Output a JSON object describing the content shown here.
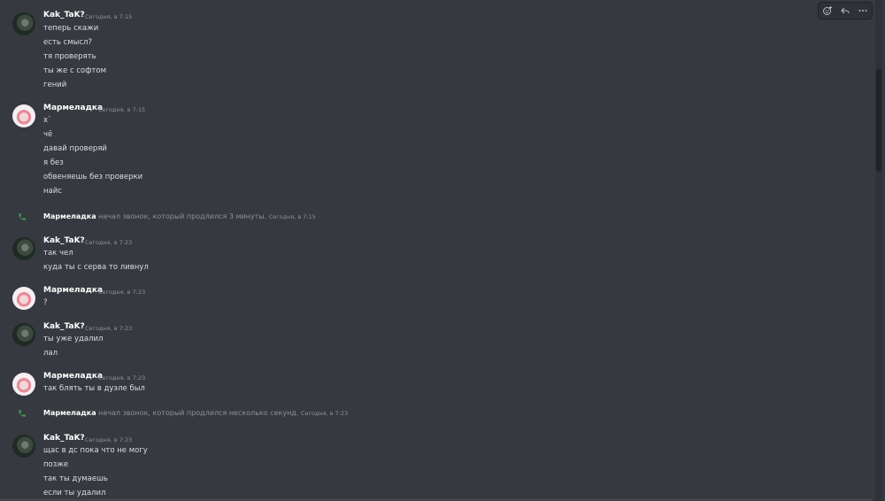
{
  "colors": {
    "background": "#36393f",
    "call_icon": "#3ba55c"
  },
  "toolbar": {
    "icons": [
      "add-reaction-icon",
      "reply-icon",
      "more-icon"
    ]
  },
  "messages": [
    {
      "author": "Kak_TaK?",
      "timestamp": "Сегодня, в 7:15",
      "avatar": "cat-avatar",
      "lines": [
        "теперь скажи",
        "есть смысл?",
        "тя проверять",
        "ты же с софтом",
        "гений"
      ]
    },
    {
      "author": "Мармеладка",
      "timestamp": "Сегодня, в 7:15",
      "avatar": "anime-avatar",
      "lines": [
        "х`",
        "чё",
        "давай проверяй",
        "я без",
        "обвеняешь без проверки",
        "найс"
      ]
    },
    {
      "type": "call",
      "author": "Мармеладка",
      "text": "начал звонок, который продлился 3 минуты.",
      "timestamp": "Сегодня, в 7:15"
    },
    {
      "author": "Kak_TaK?",
      "timestamp": "Сегодня, в 7:23",
      "avatar": "cat-avatar",
      "lines": [
        "так чел",
        "куда ты с серва то ливнул"
      ]
    },
    {
      "author": "Мармеладка",
      "timestamp": "Сегодня, в 7:23",
      "avatar": "anime-avatar",
      "lines": [
        "?"
      ]
    },
    {
      "author": "Kak_TaK?",
      "timestamp": "Сегодня, в 7:23",
      "avatar": "cat-avatar",
      "lines": [
        "ты уже удалил",
        "лал"
      ]
    },
    {
      "author": "Мармеладка",
      "timestamp": "Сегодня, в 7:23",
      "avatar": "anime-avatar",
      "lines": [
        "так блять ты в дуэле был"
      ]
    },
    {
      "type": "call",
      "author": "Мармеладка",
      "text": "начал звонок, который продлился несколько секунд.",
      "timestamp": "Сегодня, в 7:23"
    },
    {
      "author": "Kak_TaK?",
      "timestamp": "Сегодня, в 7:23",
      "avatar": "cat-avatar",
      "lines": [
        "щас в дс пока что не могу",
        "позже",
        "так ты думаешь",
        "если ты удалил"
      ]
    }
  ]
}
